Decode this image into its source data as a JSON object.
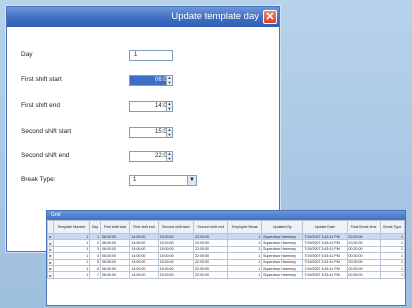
{
  "dialog": {
    "title": "Update template day",
    "fields": [
      {
        "label": "Day",
        "value": "1"
      },
      {
        "label": "First shift start",
        "value": "06:00"
      },
      {
        "label": "First shift end",
        "value": "14:00"
      },
      {
        "label": "Second shift start",
        "value": "15:00"
      },
      {
        "label": "Second shift end",
        "value": "22:00"
      }
    ],
    "break_type": {
      "label": "Break Type:",
      "value": "1"
    }
  },
  "grid": {
    "title": "Grid",
    "columns": [
      "Template Number",
      "Day",
      "First shift start",
      "First shift end",
      "Second shift start",
      "Second shift end",
      "Employee Break",
      "Updated By",
      "Update Date",
      "Total Break time",
      "Break Type"
    ],
    "rows": [
      [
        "1",
        "1",
        "06:00:00",
        "14:00:00",
        "15:00:00",
        "22:00:00",
        "1",
        "Supervisor Harmony",
        "7/19/2007 3:43:41 PM",
        "00:30:00",
        "1"
      ],
      [
        "1",
        "2",
        "06:00:00",
        "14:00:00",
        "15:00:00",
        "22:00:00",
        "1",
        "Supervisor Harmony",
        "7/19/2007 3:43:41 PM",
        "00:30:00",
        "1"
      ],
      [
        "1",
        "3",
        "06:00:00",
        "14:00:00",
        "15:00:00",
        "22:00:00",
        "1",
        "Supervisor Harmony",
        "7/19/2007 3:43:41 PM",
        "00:30:00",
        "1"
      ],
      [
        "1",
        "4",
        "06:00:00",
        "14:00:00",
        "15:00:00",
        "22:00:00",
        "1",
        "Supervisor Harmony",
        "7/19/2007 3:43:41 PM",
        "00:30:00",
        "1"
      ],
      [
        "1",
        "5",
        "06:00:00",
        "14:00:00",
        "15:00:00",
        "22:00:00",
        "1",
        "Supervisor Harmony",
        "7/19/2007 3:43:41 PM",
        "00:30:00",
        "1"
      ],
      [
        "1",
        "6",
        "06:00:00",
        "14:00:00",
        "15:00:00",
        "22:00:00",
        "1",
        "Supervisor Harmony",
        "7/19/2007 3:43:41 PM",
        "00:30:00",
        "1"
      ],
      [
        "1",
        "7",
        "06:00:00",
        "14:00:00",
        "15:00:00",
        "22:00:00",
        "1",
        "Supervisor Harmony",
        "7/19/2007 3:43:41 PM",
        "00:30:00",
        "1"
      ]
    ]
  }
}
